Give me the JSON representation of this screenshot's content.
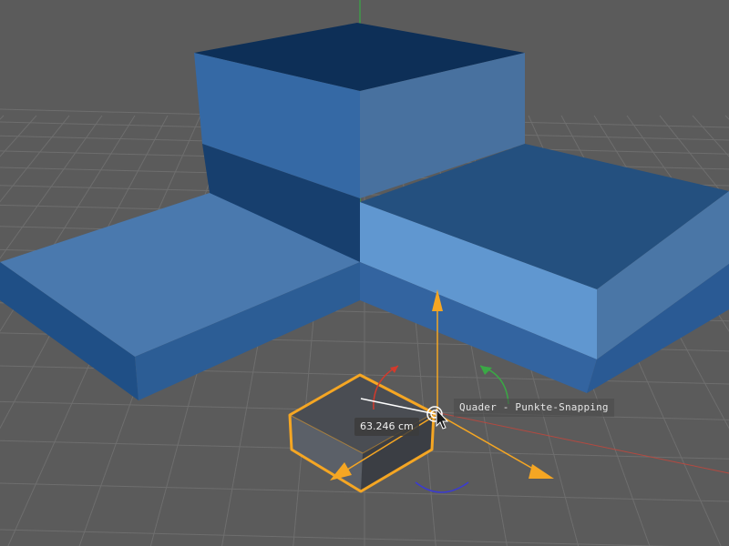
{
  "viewport": {
    "snapping_tooltip": "Quader - Punkte-Snapping",
    "distance_readout": "63.246 cm",
    "colors": {
      "background": "#5b5b5b",
      "grid": "#6c6c6c",
      "selection": "#f5a623",
      "x_axis": "#d33a2c",
      "y_axis": "#3aa845",
      "z_axis": "#3a3ad4",
      "mesh_blue": "#3d6fa8"
    },
    "icons": {
      "snap_cursor": "snap-target-icon",
      "mouse_pointer": "arrow-cursor-icon"
    }
  }
}
